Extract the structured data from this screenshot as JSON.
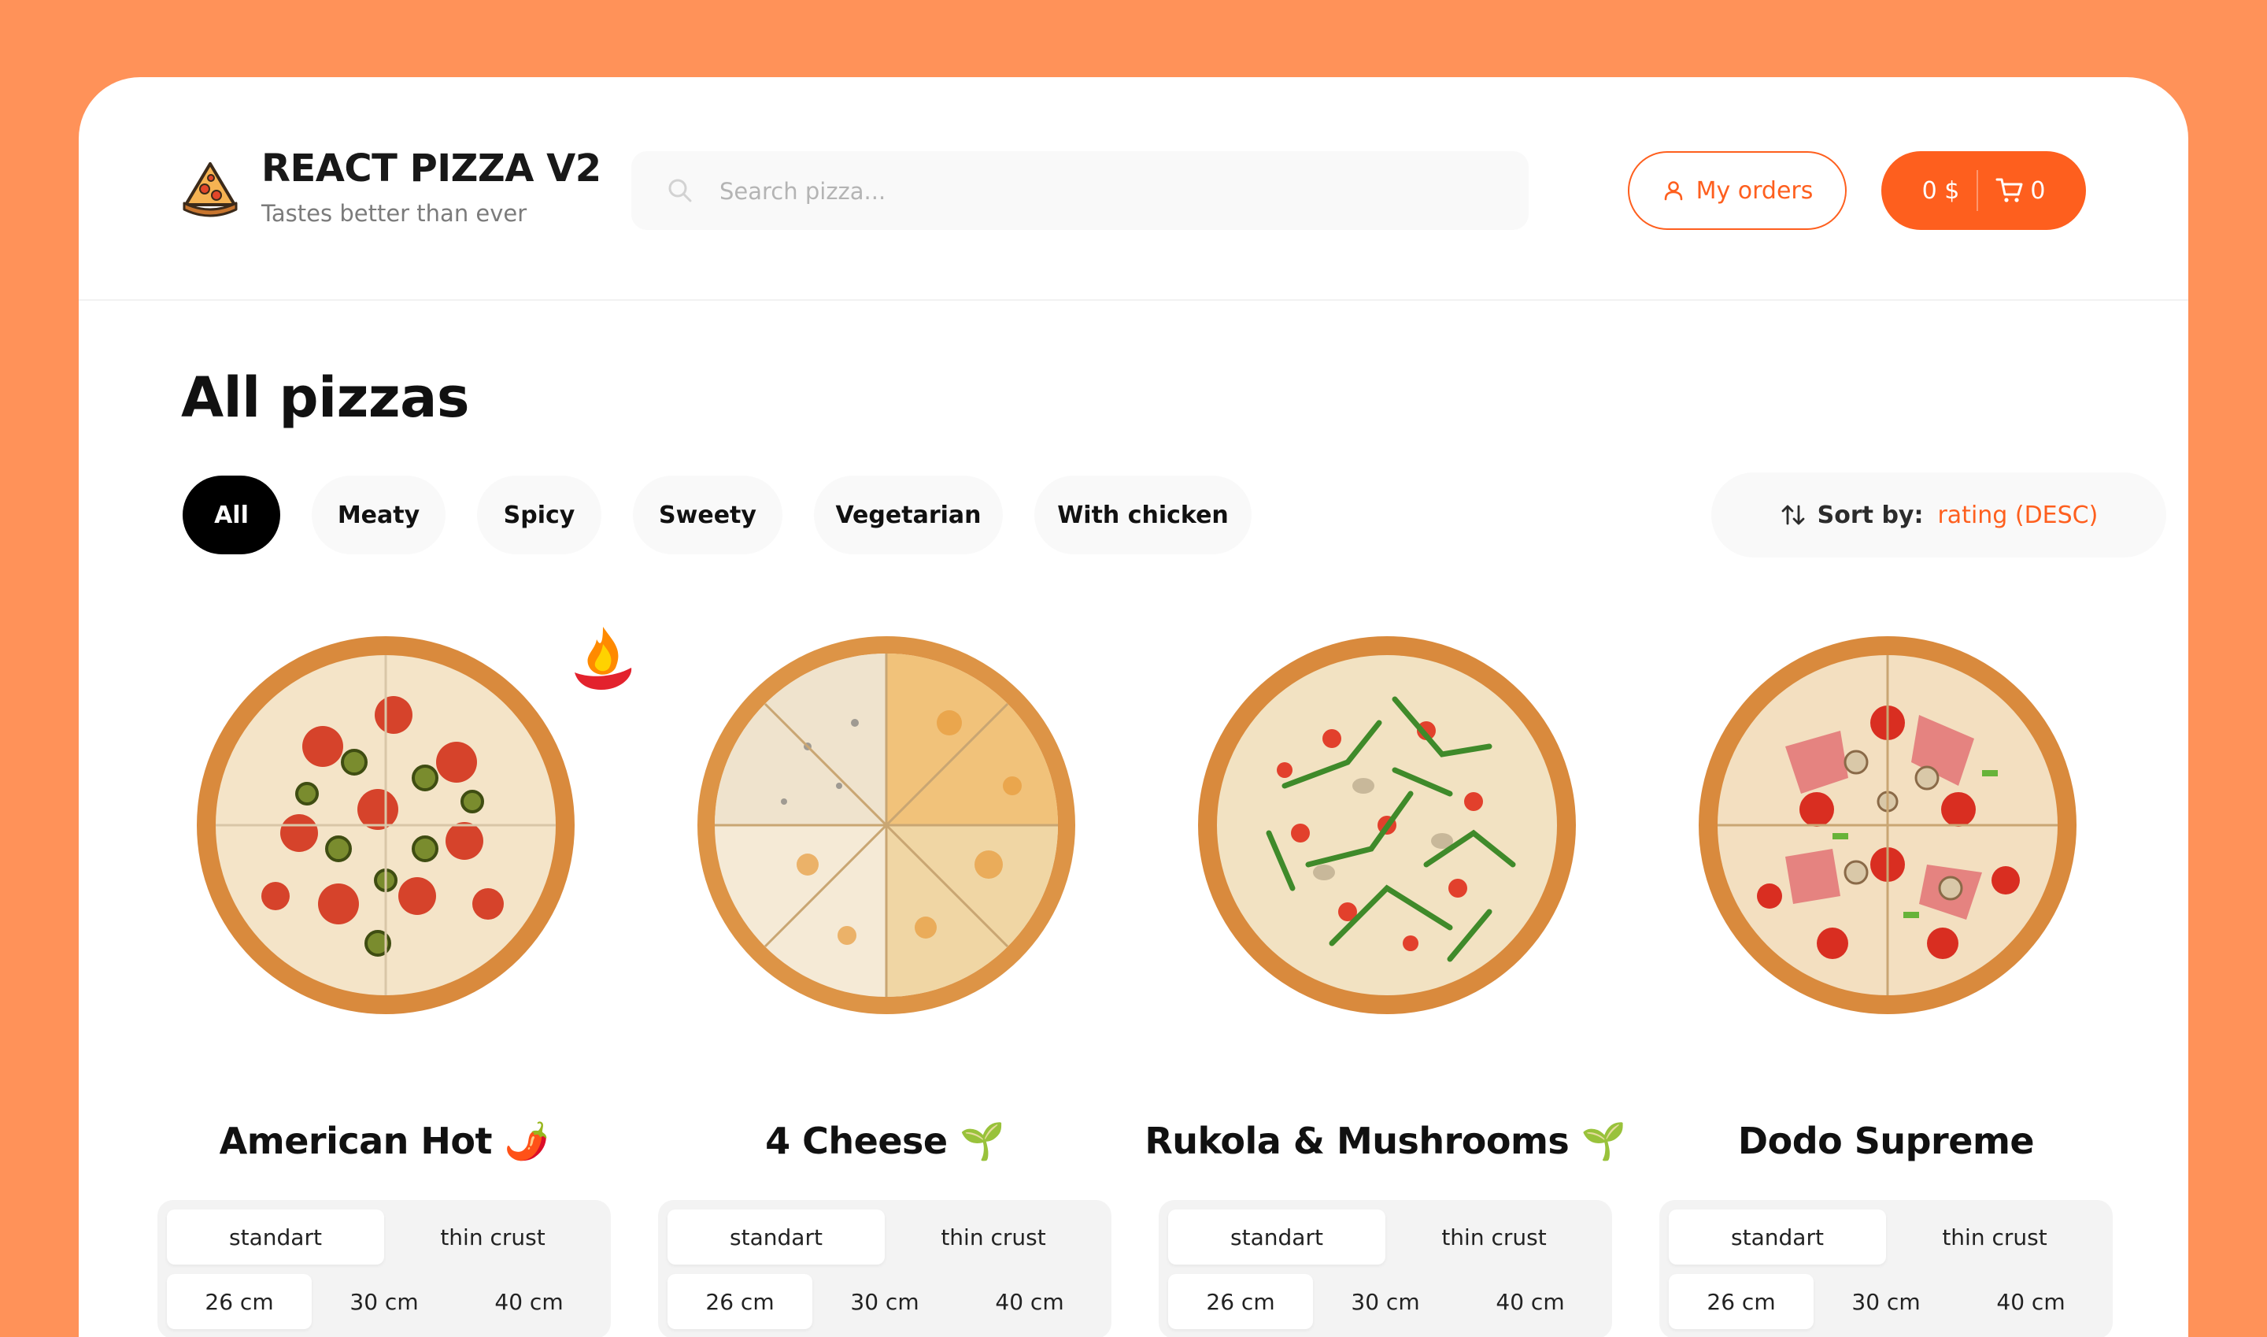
{
  "header": {
    "logo_title": "REACT PIZZA V2",
    "logo_subtitle": "Tastes better than ever",
    "search_placeholder": "Search pizza...",
    "orders_label": "My orders",
    "cart_price": "0 $",
    "cart_count": "0"
  },
  "page_title": "All pizzas",
  "categories": [
    {
      "label": "All",
      "active": true
    },
    {
      "label": "Meaty",
      "active": false
    },
    {
      "label": "Spicy",
      "active": false
    },
    {
      "label": "Sweety",
      "active": false
    },
    {
      "label": "Vegetarian",
      "active": false
    },
    {
      "label": "With chicken",
      "active": false
    }
  ],
  "sort": {
    "label": "Sort by:",
    "value": "rating (DESC)"
  },
  "pizzas": [
    {
      "name": "American Hot 🌶️",
      "types": [
        "standart",
        "thin crust"
      ],
      "sizes": [
        "26 cm",
        "30 cm",
        "40 cm"
      ],
      "selected_type": 0,
      "selected_size": 0,
      "badge": "spicy-badge-icon"
    },
    {
      "name": "4 Cheese 🌱",
      "types": [
        "standart",
        "thin crust"
      ],
      "sizes": [
        "26 cm",
        "30 cm",
        "40 cm"
      ],
      "selected_type": 0,
      "selected_size": 0
    },
    {
      "name": "Rukola & Mushrooms 🌱",
      "types": [
        "standart",
        "thin crust"
      ],
      "sizes": [
        "26 cm",
        "30 cm",
        "40 cm"
      ],
      "selected_type": 0,
      "selected_size": 0
    },
    {
      "name": "Dodo Supreme",
      "types": [
        "standart",
        "thin crust"
      ],
      "sizes": [
        "26 cm",
        "30 cm",
        "40 cm"
      ],
      "selected_type": 0,
      "selected_size": 0
    }
  ],
  "colors": {
    "accent": "#fe5f1e",
    "page_background": "#ff9259",
    "chip_background": "#f9f9f9"
  }
}
